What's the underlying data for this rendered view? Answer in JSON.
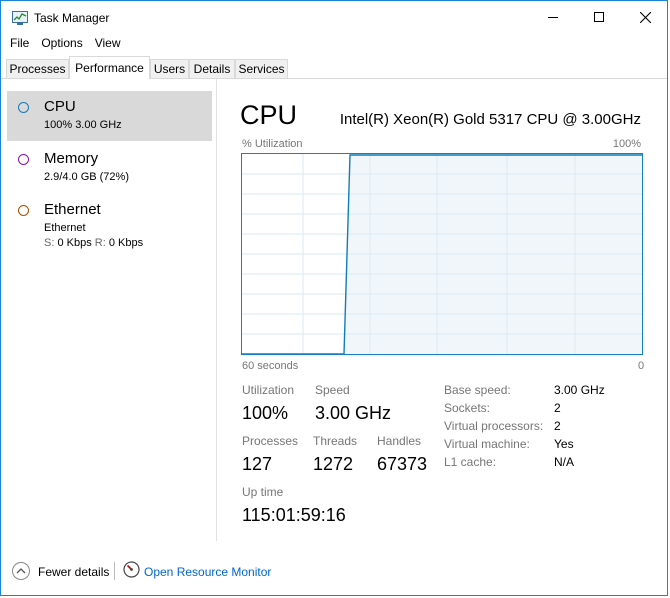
{
  "window": {
    "title": "Task Manager"
  },
  "menu": [
    "File",
    "Options",
    "View"
  ],
  "tabs": [
    "Processes",
    "Performance",
    "Users",
    "Details",
    "Services"
  ],
  "active_tab": "Performance",
  "resources": [
    {
      "name": "CPU",
      "line1": "100%  3.00 GHz",
      "circle_color": "#117dbb",
      "selected": true
    },
    {
      "name": "Memory",
      "line1": "2.9/4.0 GB (72%)",
      "circle_color": "#8b12ae"
    },
    {
      "name": "Ethernet",
      "line1": "Ethernet",
      "send_label": "S:",
      "send_value": "0 Kbps",
      "recv_label": "R:",
      "recv_value": "0 Kbps",
      "circle_color": "#a74f01"
    }
  ],
  "cpu": {
    "title": "CPU",
    "model": "Intel(R) Xeon(R) Gold 5317 CPU @ 3.00GHz",
    "graph": {
      "y_label": "% Utilization",
      "y_max_label": "100%",
      "x_left_label": "60 seconds",
      "x_right_label": "0",
      "line_color": "#117dbb",
      "fill_color": "#f1f6fa",
      "utilization_series_note": "",
      "utilization_start_fraction": 0.0,
      "utilization_jump_at_fraction": 0.27,
      "utilization_level": 1.0
    },
    "stats": {
      "utilization_label": "Utilization",
      "utilization": "100%",
      "speed_label": "Speed",
      "speed": "3.00 GHz",
      "processes_label": "Processes",
      "processes": "127",
      "threads_label": "Threads",
      "threads": "1272",
      "handles_label": "Handles",
      "handles": "67373",
      "uptime_label": "Up time",
      "uptime": "115:01:59:16"
    },
    "info": [
      {
        "label": "Base speed:",
        "value": "3.00 GHz"
      },
      {
        "label": "Sockets:",
        "value": "2"
      },
      {
        "label": "Virtual processors:",
        "value": "2"
      },
      {
        "label": "Virtual machine:",
        "value": "Yes"
      },
      {
        "label": "L1 cache:",
        "value": "N/A"
      }
    ]
  },
  "footer": {
    "fewer_details": "Fewer details",
    "open_monitor": "Open Resource Monitor"
  }
}
